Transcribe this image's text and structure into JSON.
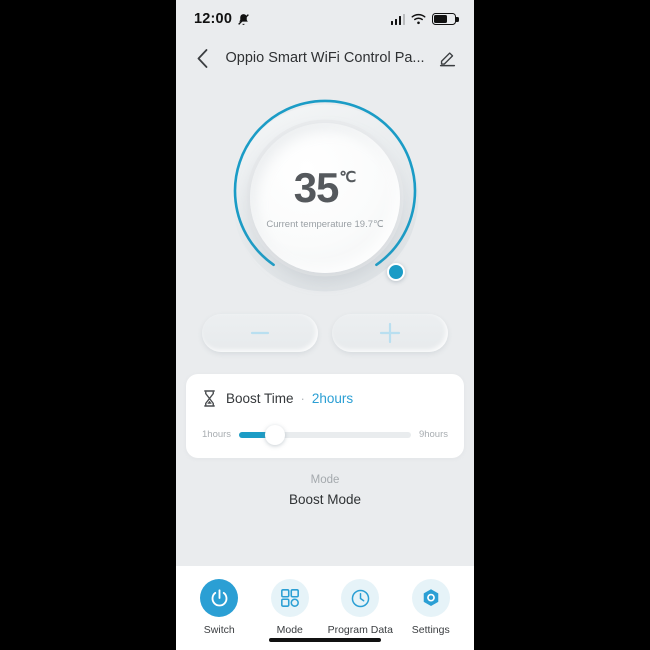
{
  "status_bar": {
    "time": "12:00",
    "mute_icon": "bell-muted-icon",
    "signal_icon": "cellular-signal-icon",
    "wifi_icon": "wifi-icon",
    "battery_icon": "battery-icon"
  },
  "header": {
    "back_icon": "chevron-left-icon",
    "title": "Oppio Smart WiFi Control Pa...",
    "edit_icon": "edit-pencil-icon"
  },
  "dial": {
    "target_temperature": "35",
    "unit": "℃",
    "current_temperature_text": "Current temperature 19.7℃",
    "arc_color": "#1b9cc6",
    "track_color": "#dfe3e6",
    "knob_name": "dial-knob"
  },
  "adjust": {
    "decrease_label": "−",
    "increase_label": "+",
    "icon_color": "#b9dff0"
  },
  "boost": {
    "icon": "hourglass-icon",
    "label": "Boost Time",
    "separator": "·",
    "value": "2hours",
    "value_color": "#2b9fd4",
    "slider_min_label": "1hours",
    "slider_max_label": "9hours",
    "slider_percent": 21
  },
  "mode": {
    "caption": "Mode",
    "name": "Boost Mode"
  },
  "nav": {
    "items": [
      {
        "label": "Switch",
        "icon": "power-icon",
        "active": true
      },
      {
        "label": "Mode",
        "icon": "grid-squares-icon",
        "active": false
      },
      {
        "label": "Program Data",
        "icon": "clock-icon",
        "active": false
      },
      {
        "label": "Settings",
        "icon": "hexagon-gear-icon",
        "active": false
      }
    ],
    "accent_color": "#2b9fd4",
    "inactive_bg": "#e6f3f8"
  }
}
